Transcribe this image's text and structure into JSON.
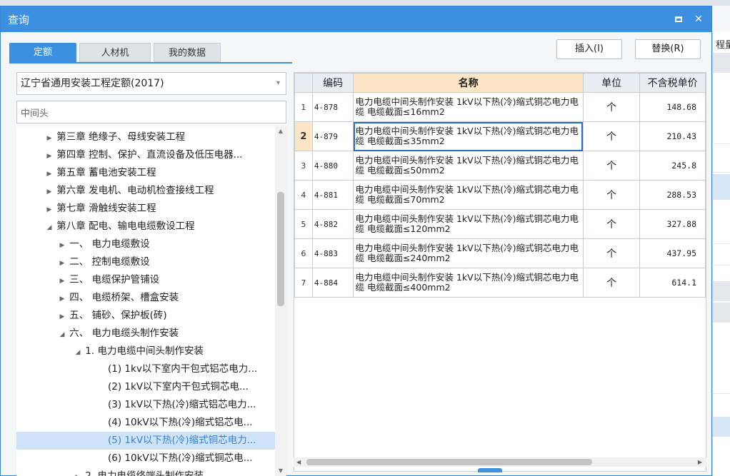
{
  "window": {
    "title": "查询"
  },
  "background": {
    "right_label": "程量"
  },
  "tabs": [
    {
      "label": "定额",
      "active": true
    },
    {
      "label": "人材机",
      "active": false
    },
    {
      "label": "我的数据",
      "active": false
    }
  ],
  "buttons": {
    "insert": "插入(I)",
    "replace": "替换(R)"
  },
  "library_select": {
    "value": "辽宁省通用安装工程定额(2017)"
  },
  "search": {
    "value": "中间头"
  },
  "tree": [
    {
      "label": "第三章 绝缘子、母线安装工程",
      "level": 0,
      "expanded": false
    },
    {
      "label": "第四章 控制、保护、直流设备及低压电器...",
      "level": 0,
      "expanded": false
    },
    {
      "label": "第五章 蓄电池安装工程",
      "level": 0,
      "expanded": false
    },
    {
      "label": "第六章 发电机、电动机检查接线工程",
      "level": 0,
      "expanded": false
    },
    {
      "label": "第七章 滑触线安装工程",
      "level": 0,
      "expanded": false
    },
    {
      "label": "第八章 配电、输电电缆敷设工程",
      "level": 0,
      "expanded": true
    },
    {
      "label": "一、 电力电缆敷设",
      "level": 1,
      "expanded": false
    },
    {
      "label": "二、 控制电缆敷设",
      "level": 1,
      "expanded": false
    },
    {
      "label": "三、 电缆保护管铺设",
      "level": 1,
      "expanded": false
    },
    {
      "label": "四、 电缆桥架、槽盒安装",
      "level": 1,
      "expanded": false
    },
    {
      "label": "五、 铺砂、保护板(砖)",
      "level": 1,
      "expanded": false
    },
    {
      "label": "六、 电力电缆头制作安装",
      "level": 1,
      "expanded": true
    },
    {
      "label": "1. 电力电缆中间头制作安装",
      "level": 2,
      "expanded": true
    },
    {
      "label": "(1) 1kv以下室内干包式铝芯电力...",
      "level": 3,
      "leaf": true
    },
    {
      "label": "(2) 1kV以下室内干包式铜芯电...",
      "level": 3,
      "leaf": true
    },
    {
      "label": "(3) 1kV以下热(冷)缩式铝芯电力...",
      "level": 3,
      "leaf": true
    },
    {
      "label": "(4) 10kV以下热(冷)缩式铝芯电...",
      "level": 3,
      "leaf": true
    },
    {
      "label": "(5) 1kV以下热(冷)缩式铜芯电力...",
      "level": 3,
      "leaf": true,
      "selected": true
    },
    {
      "label": "(6) 10kV以下热(冷)缩式铜芯电...",
      "level": 3,
      "leaf": true
    },
    {
      "label": "2. 电力电缆终端头制作安装",
      "level": 2,
      "expanded": false
    }
  ],
  "grid": {
    "columns": [
      "",
      "编码",
      "名称",
      "单位",
      "不含税单价"
    ],
    "current_row": 2,
    "rows": [
      {
        "idx": "1",
        "code": "4-878",
        "name": "电力电缆中间头制作安装 1kV以下热(冷)缩式铜芯电力电缆 电缆截面≤16mm2",
        "unit": "个",
        "price": "148.68"
      },
      {
        "idx": "2",
        "code": "4-879",
        "name": "电力电缆中间头制作安装 1kV以下热(冷)缩式铜芯电力电缆 电缆截面≤35mm2",
        "unit": "个",
        "price": "210.43"
      },
      {
        "idx": "3",
        "code": "4-880",
        "name": "电力电缆中间头制作安装 1kV以下热(冷)缩式铜芯电力电缆 电缆截面≤50mm2",
        "unit": "个",
        "price": "245.8"
      },
      {
        "idx": "4",
        "code": "4-881",
        "name": "电力电缆中间头制作安装 1kV以下热(冷)缩式铜芯电力电缆 电缆截面≤70mm2",
        "unit": "个",
        "price": "288.53"
      },
      {
        "idx": "5",
        "code": "4-882",
        "name": "电力电缆中间头制作安装 1kV以下热(冷)缩式铜芯电力电缆 电缆截面≤120mm2",
        "unit": "个",
        "price": "327.88"
      },
      {
        "idx": "6",
        "code": "4-883",
        "name": "电力电缆中间头制作安装 1kV以下热(冷)缩式铜芯电力电缆 电缆截面≤240mm2",
        "unit": "个",
        "price": "437.95"
      },
      {
        "idx": "7",
        "code": "4-884",
        "name": "电力电缆中间头制作安装 1kV以下热(冷)缩式铜芯电力电缆 电缆截面≤400mm2",
        "unit": "个",
        "price": "614.1"
      }
    ]
  },
  "colors": {
    "accent": "#3d8fe0",
    "header_highlight": "#fbe5c4",
    "selection": "#cfe3f8"
  }
}
